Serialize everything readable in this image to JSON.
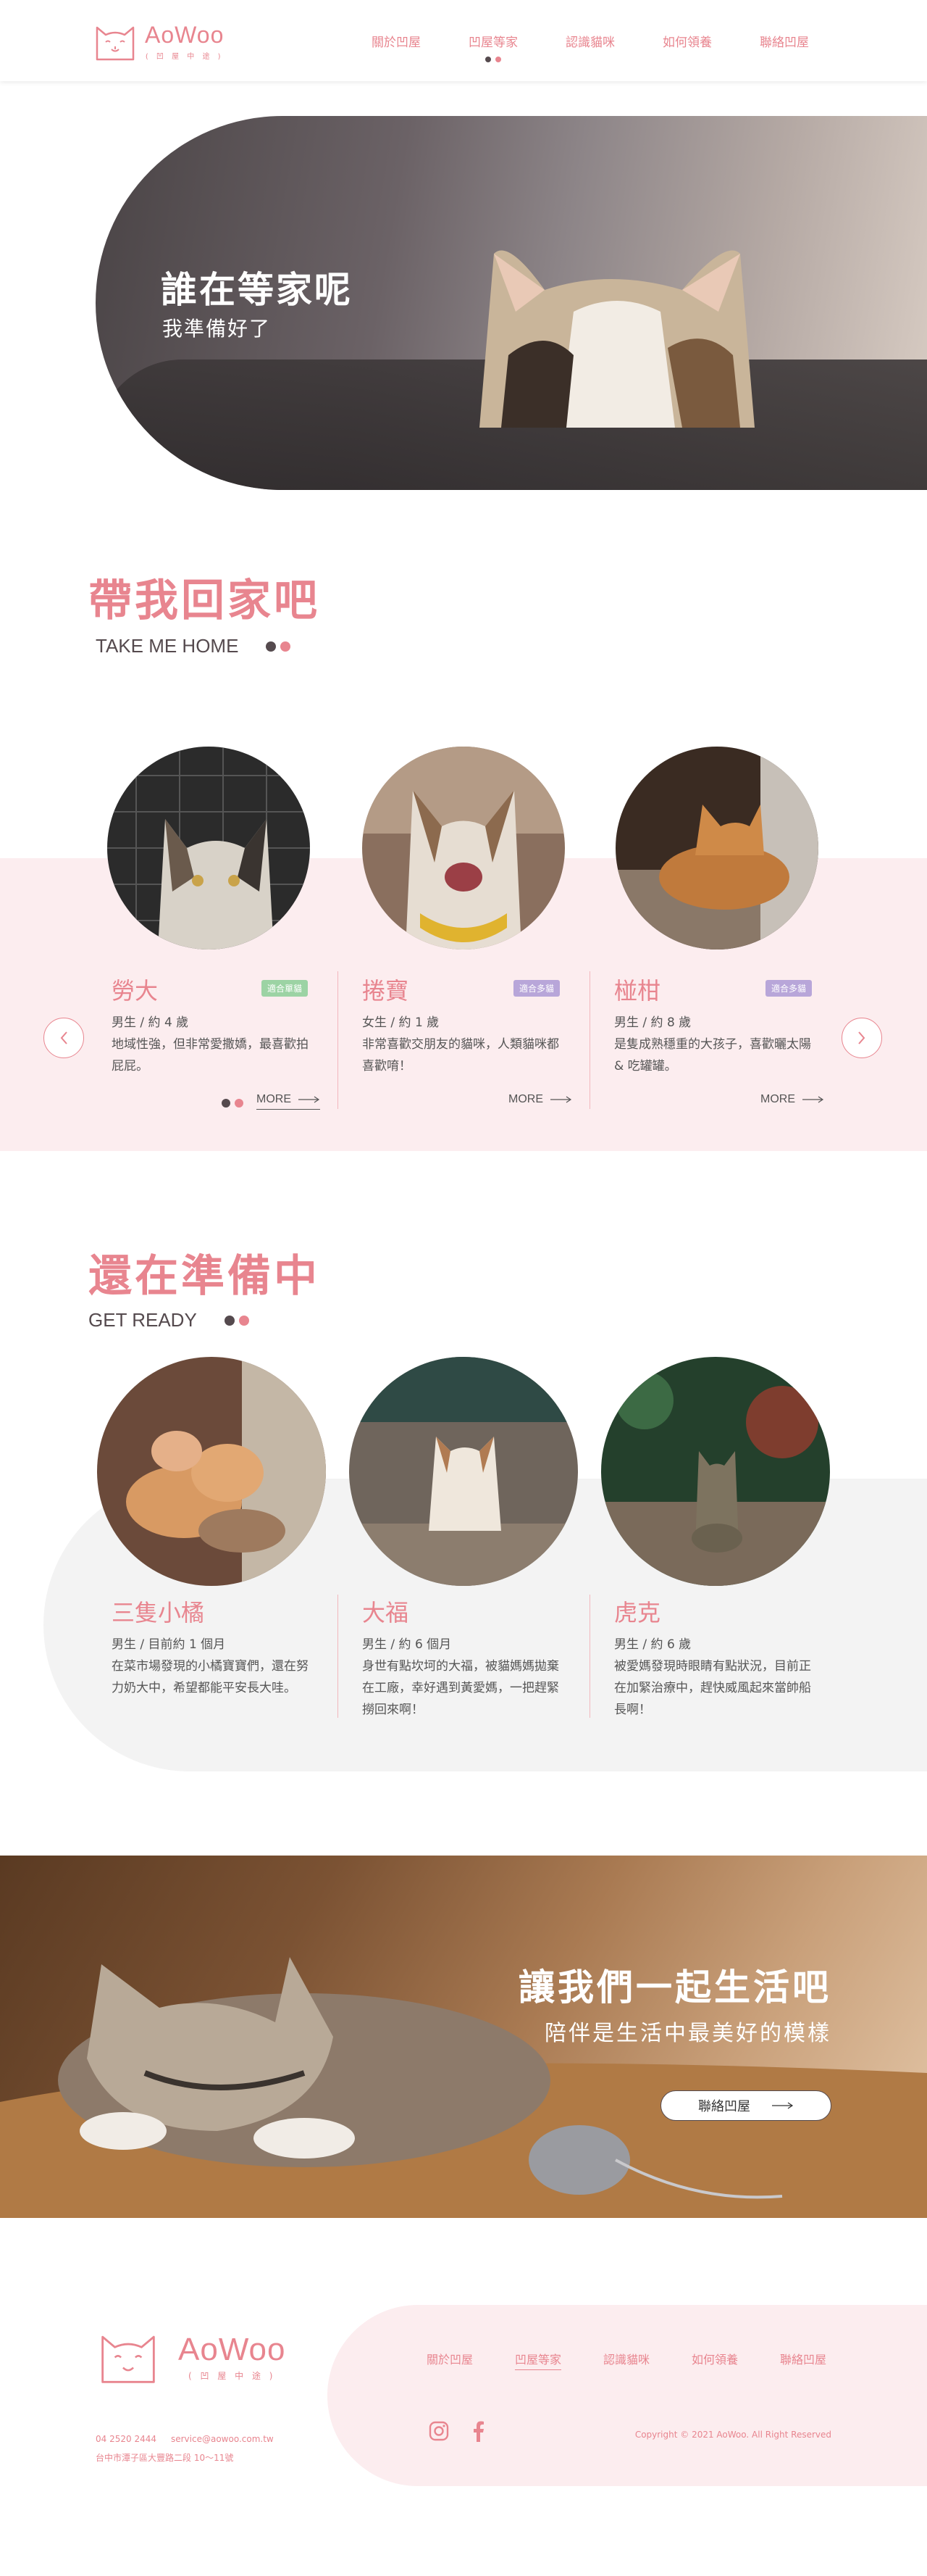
{
  "header": {
    "logo_name": "AoWoo",
    "logo_sub": "( 凹 屋 中 途 )",
    "nav": [
      "關於凹屋",
      "凹屋等家",
      "認識貓咪",
      "如何領養",
      "聯絡凹屋"
    ],
    "active_nav": 1
  },
  "hero": {
    "title": "誰在等家呢",
    "subtitle": "我準備好了"
  },
  "take_me_home": {
    "title": "帶我回家吧",
    "subtitle": "TAKE ME HOME",
    "prev_icon": "chevron-left-icon",
    "next_icon": "chevron-right-icon",
    "cards": [
      {
        "name": "勞大",
        "tag": "適合單貓",
        "tag_color": "#9cd3a4",
        "info": "男生 / 約 4 歲",
        "desc": "地域性強，但非常愛撒嬌，最喜歡拍屁屁。",
        "more": "MORE"
      },
      {
        "name": "捲寶",
        "tag": "適合多貓",
        "tag_color": "#b8a6d9",
        "info": "女生 / 約 1 歲",
        "desc": "非常喜歡交朋友的貓咪，人類貓咪都喜歡唷！",
        "more": "MORE"
      },
      {
        "name": "椪柑",
        "tag": "適合多貓",
        "tag_color": "#b8a6d9",
        "info": "男生 / 約 8 歲",
        "desc": "是隻成熟穩重的大孩子，喜歡曬太陽 & 吃罐罐。",
        "more": "MORE"
      }
    ]
  },
  "get_ready": {
    "title": "還在準備中",
    "subtitle": "GET READY",
    "cards": [
      {
        "name": "三隻小橘",
        "info": "男生 / 目前約 1 個月",
        "desc": "在菜市場發現的小橘寶寶們，還在努力奶大中，希望都能平安長大哇。"
      },
      {
        "name": "大福",
        "info": "男生 / 約 6 個月",
        "desc": "身世有點坎坷的大福，被貓媽媽拋棄在工廠，幸好遇到黃愛媽，一把趕緊撈回來啊！"
      },
      {
        "name": "虎克",
        "info": "男生 / 約 6 歲",
        "desc": "被愛媽發現時眼睛有點狀況，目前正在加緊治療中，趕快威風起來當帥船長啊！"
      }
    ]
  },
  "banner": {
    "title": "讓我們一起生活吧",
    "subtitle": "陪伴是生活中最美好的模樣",
    "button": "聯絡凹屋"
  },
  "footer": {
    "logo_name": "AoWoo",
    "logo_sub": "( 凹 屋 中 途 )",
    "nav": [
      "關於凹屋",
      "凹屋等家",
      "認識貓咪",
      "如何領養",
      "聯絡凹屋"
    ],
    "active_nav": 1,
    "phone": "04 2520 2444",
    "email": "service@aowoo.com.tw",
    "address": "台中市潭子區大豐路二段 10～11號",
    "copyright": "Copyright © 2021 AoWoo. All Right Reserved",
    "social": [
      "instagram-icon",
      "facebook-icon"
    ]
  },
  "colors": {
    "accent": "#e8858f",
    "dark": "#554a4e",
    "pink_bg": "#fcedef",
    "grey_bg": "#f3f3f3"
  }
}
